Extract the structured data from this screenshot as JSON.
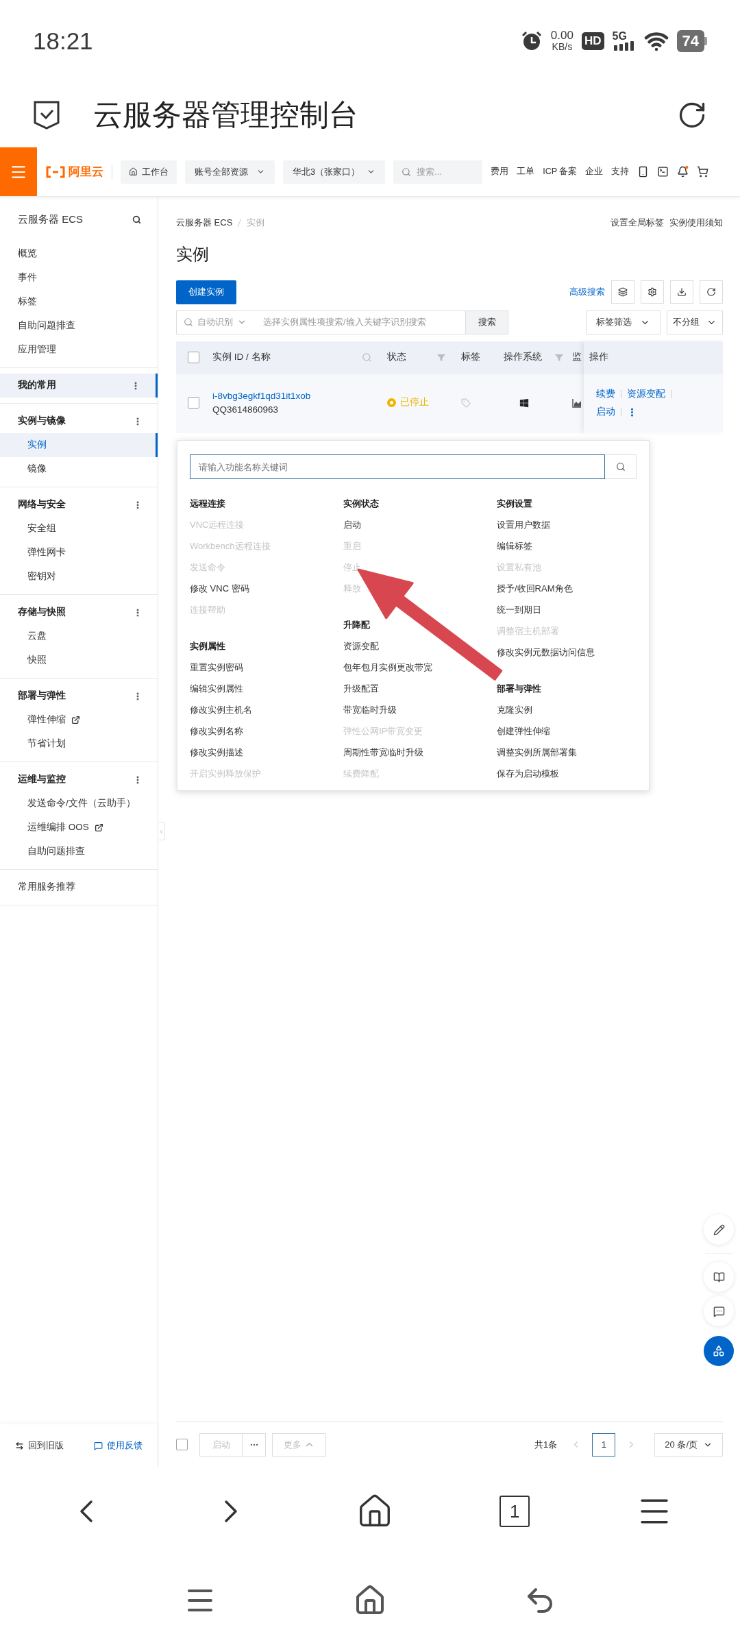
{
  "status_bar": {
    "time": "18:21",
    "net_speed": "0.00",
    "net_unit": "KB/s",
    "hd": "HD",
    "network": "5G",
    "battery": "74"
  },
  "browser": {
    "title": "云服务器管理控制台"
  },
  "topbar": {
    "logo": "阿里云",
    "workbench": "工作台",
    "resource": "账号全部资源",
    "region": "华北3（张家口）",
    "search_placeholder": "搜索...",
    "links": [
      "费用",
      "工单",
      "ICP 备案",
      "企业",
      "支持"
    ]
  },
  "sidebar": {
    "title": "云服务器 ECS",
    "items": [
      {
        "label": "概览",
        "selected": false
      },
      {
        "label": "事件",
        "selected": false
      },
      {
        "label": "标签",
        "selected": false
      },
      {
        "label": "自助问题排查",
        "selected": false
      },
      {
        "label": "应用管理",
        "selected": false
      }
    ],
    "groups": [
      {
        "title": "我的常用",
        "selected": true
      },
      {
        "title": "实例与镜像",
        "selected": false,
        "items": [
          {
            "label": "实例",
            "selected": true,
            "external": false
          },
          {
            "label": "镜像",
            "selected": false,
            "external": false
          }
        ]
      },
      {
        "title": "网络与安全",
        "selected": false,
        "items": [
          {
            "label": "安全组",
            "selected": false,
            "external": false
          },
          {
            "label": "弹性网卡",
            "selected": false,
            "external": false
          },
          {
            "label": "密钥对",
            "selected": false,
            "external": false
          }
        ]
      },
      {
        "title": "存储与快照",
        "selected": false,
        "items": [
          {
            "label": "云盘",
            "selected": false,
            "external": false
          },
          {
            "label": "快照",
            "selected": false,
            "external": false
          }
        ]
      },
      {
        "title": "部署与弹性",
        "selected": false,
        "items": [
          {
            "label": "弹性伸缩",
            "selected": false,
            "external": true
          },
          {
            "label": "节省计划",
            "selected": false,
            "external": false
          }
        ]
      },
      {
        "title": "运维与监控",
        "selected": false,
        "items": [
          {
            "label": "发送命令/文件（云助手）",
            "selected": false,
            "external": false
          },
          {
            "label": "运维编排 OOS",
            "selected": false,
            "external": true
          },
          {
            "label": "自助问题排查",
            "selected": false,
            "external": false
          }
        ]
      }
    ],
    "recommend": "常用服务推荐",
    "footer": {
      "old_version": "回到旧版",
      "feedback": "使用反馈"
    }
  },
  "breadcrumb": [
    "云服务器 ECS",
    "实例"
  ],
  "header_links": [
    "设置全局标签",
    "实例使用须知"
  ],
  "page_title": "实例",
  "create_button": "创建实例",
  "advanced_search": "高级搜索",
  "search": {
    "mode": "自动识别",
    "placeholder": "选择实例属性项搜索/输入关键字识别搜索",
    "button": "搜索"
  },
  "tag_filter": "标签筛选",
  "grouping": "不分组",
  "table": {
    "select_all_checked": false,
    "columns": [
      {
        "label": "实例 ID / 名称"
      },
      {
        "label": "状态"
      },
      {
        "label": "标签"
      },
      {
        "label": "操作系统"
      },
      {
        "label": "监"
      },
      {
        "label": "操作"
      }
    ],
    "rows": [
      {
        "checked": false,
        "id": "i-8vbg3egkf1qd31it1xob",
        "name": "QQ3614860963",
        "status": "已停止",
        "color": "#f0b400",
        "actions": [
          "续费",
          "资源变配",
          "启动"
        ]
      }
    ]
  },
  "popup": {
    "placeholder": "请输入功能名称关键词",
    "columns": [
      [
        {
          "heading": "远程连接",
          "items": [
            {
              "label": "VNC远程连接",
              "disabled": true
            },
            {
              "label": "Workbench远程连接",
              "disabled": true
            },
            {
              "label": "发送命令",
              "disabled": true
            },
            {
              "label": "修改 VNC 密码",
              "disabled": false
            },
            {
              "label": "连接帮助",
              "disabled": true
            }
          ]
        },
        {
          "heading": "实例属性",
          "items": [
            {
              "label": "重置实例密码",
              "disabled": false
            },
            {
              "label": "编辑实例属性",
              "disabled": false
            },
            {
              "label": "修改实例主机名",
              "disabled": false
            },
            {
              "label": "修改实例名称",
              "disabled": false
            },
            {
              "label": "修改实例描述",
              "disabled": false
            },
            {
              "label": "开启实例释放保护",
              "disabled": true
            }
          ]
        }
      ],
      [
        {
          "heading": "实例状态",
          "items": [
            {
              "label": "启动",
              "disabled": false
            },
            {
              "label": "重启",
              "disabled": true
            },
            {
              "label": "停止",
              "disabled": true
            },
            {
              "label": "释放",
              "disabled": true
            }
          ]
        },
        {
          "heading": "升降配",
          "items": [
            {
              "label": "资源变配",
              "disabled": false
            },
            {
              "label": "包年包月实例更改带宽",
              "disabled": false
            },
            {
              "label": "升级配置",
              "disabled": false
            },
            {
              "label": "带宽临时升级",
              "disabled": false
            },
            {
              "label": "弹性公网IP带宽变更",
              "disabled": true
            },
            {
              "label": "周期性带宽临时升级",
              "disabled": false
            },
            {
              "label": "续费降配",
              "disabled": true
            }
          ]
        }
      ],
      [
        {
          "heading": "实例设置",
          "items": [
            {
              "label": "设置用户数据",
              "disabled": false
            },
            {
              "label": "编辑标签",
              "disabled": false
            },
            {
              "label": "设置私有池",
              "disabled": true
            },
            {
              "label": "授予/收回RAM角色",
              "disabled": false
            },
            {
              "label": "统一到期日",
              "disabled": false
            },
            {
              "label": "调整宿主机部署",
              "disabled": true
            },
            {
              "label": "修改实例元数据访问信息",
              "disabled": false
            }
          ]
        },
        {
          "heading": "部署与弹性",
          "items": [
            {
              "label": "克隆实例",
              "disabled": false
            },
            {
              "label": "创建弹性伸缩",
              "disabled": false
            },
            {
              "label": "调整实例所属部署集",
              "disabled": false
            },
            {
              "label": "保存为启动模板",
              "disabled": false
            }
          ]
        }
      ]
    ]
  },
  "footer_bar": {
    "select_all_checked": false,
    "buttons": [
      {
        "label": "启动",
        "disabled": true
      },
      {
        "label": "更多",
        "disabled": true
      }
    ],
    "total": "共1条",
    "pages": [
      {
        "label": "1",
        "selected": true
      }
    ],
    "page_size": "20 条/页"
  },
  "browser_nav": {
    "tab_count": "1"
  }
}
